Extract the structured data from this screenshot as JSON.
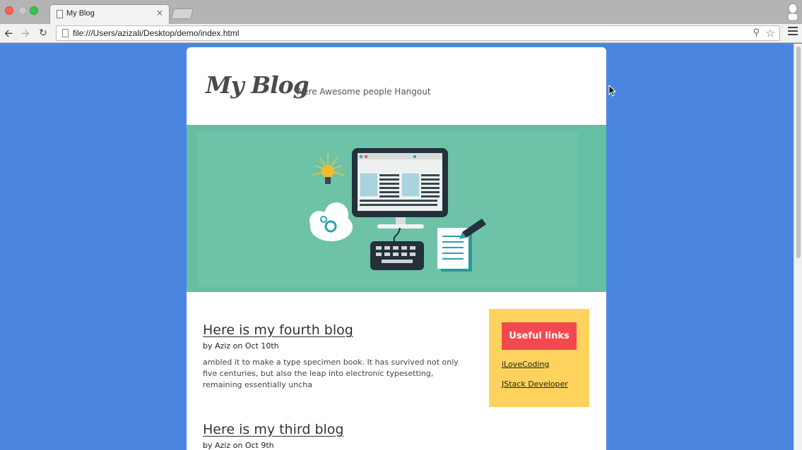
{
  "browser": {
    "tab_title": "My Blog",
    "tab_close": "×",
    "url": "file:///Users/azizali/Desktop/demo/index.html"
  },
  "site": {
    "logo": "My Blog",
    "tagline": "Were Awesome people Hangout"
  },
  "posts": [
    {
      "title": "Here is my fourth blog",
      "meta": "by Aziz on Oct 10th",
      "body": "ambled it to make a type specimen book. It has survived not only five centuries, but also the leap into electronic typesetting, remaining essentially uncha"
    },
    {
      "title": "Here is my third blog",
      "meta": "by Aziz on Oct 9th"
    }
  ],
  "sidebar": {
    "heading": "Useful links",
    "links": [
      "iLoveCoding",
      "JStack Developer"
    ]
  },
  "colors": {
    "page_bg": "#4a86df",
    "hero_bg": "#66bea3",
    "sidebar_bg": "#fdd35d",
    "sidebar_button": "#f3484e"
  }
}
